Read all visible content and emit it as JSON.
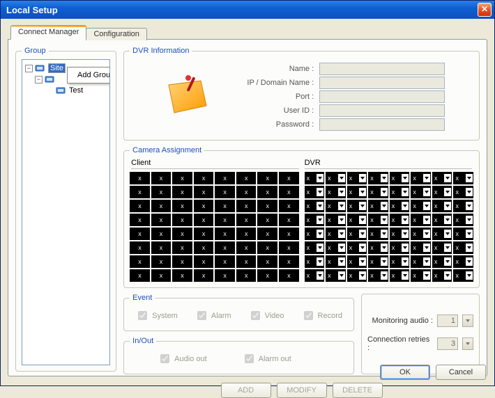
{
  "window": {
    "title": "Local Setup"
  },
  "tabs": [
    {
      "label": "Connect Manager",
      "active": true
    },
    {
      "label": "Configuration",
      "active": false
    }
  ],
  "group": {
    "legend": "Group",
    "tree": {
      "root_label": "Site",
      "child_label": "",
      "leaf_label": "Test"
    },
    "context_menu": {
      "add_group": "Add Group"
    }
  },
  "dvr_info": {
    "legend": "DVR Information",
    "fields": {
      "name_label": "Name :",
      "ip_label": "IP / Domain Name :",
      "port_label": "Port :",
      "user_label": "User ID :",
      "pass_label": "Password :",
      "name": "",
      "ip": "",
      "port": "",
      "user": "",
      "pass": ""
    }
  },
  "camera": {
    "legend": "Camera Assignment",
    "client_head": "Client",
    "dvr_head": "DVR",
    "cell_glyph": "x",
    "rows": 8,
    "cols": 8
  },
  "event": {
    "legend": "Event",
    "checks": {
      "system": "System",
      "alarm": "Alarm",
      "video": "Video",
      "record": "Record"
    }
  },
  "inout": {
    "legend": "In/Out",
    "checks": {
      "audio_out": "Audio out",
      "alarm_out": "Alarm out"
    }
  },
  "settings": {
    "monitoring_audio_label": "Monitoring audio :",
    "monitoring_audio_value": "1",
    "connection_retries_label": "Connection retries :",
    "connection_retries_value": "3"
  },
  "buttons": {
    "add": "ADD",
    "modify": "MODIFY",
    "delete": "DELETE",
    "ok": "OK",
    "cancel": "Cancel"
  }
}
